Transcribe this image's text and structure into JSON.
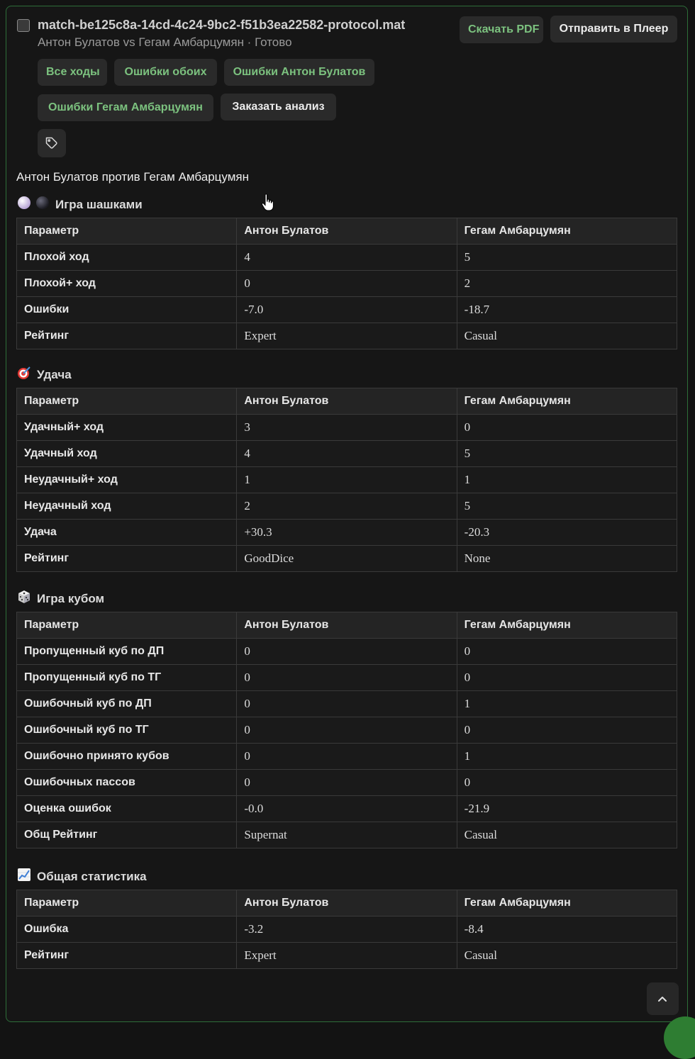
{
  "header": {
    "filename": "match-be125c8a-14cd-4c24-9bc2-f51b3ea22582-protocol.mat",
    "subtitle": "Антон Булатов vs Гегам Амбарцумян · Готово",
    "download_pdf": "Скачать PDF",
    "send_to_player": "Отправить в Плеер"
  },
  "filters": {
    "all_moves": "Все ходы",
    "both_errors": "Ошибки обоих",
    "errors_p1": "Ошибки Антон Булатов",
    "errors_p2": "Ошибки Гегам Амбарцумян",
    "order_analysis": "Заказать анализ"
  },
  "match_title": "Антон Булатов против Гегам Амбарцумян",
  "columns": [
    "Параметр",
    "Антон Булатов",
    "Гегам Амбарцумян"
  ],
  "sections": {
    "checkers": {
      "title": "Игра шашками",
      "icon": "checker-pieces-icon",
      "rows": [
        [
          "Плохой ход",
          "4",
          "5"
        ],
        [
          "Плохой+ ход",
          "0",
          "2"
        ],
        [
          "Ошибки",
          "-7.0",
          "-18.7"
        ],
        [
          "Рейтинг",
          "Expert",
          "Casual"
        ]
      ]
    },
    "luck": {
      "title": "Удача",
      "icon": "target-icon",
      "rows": [
        [
          "Удачный+ ход",
          "3",
          "0"
        ],
        [
          "Удачный ход",
          "4",
          "5"
        ],
        [
          "Неудачный+ ход",
          "1",
          "1"
        ],
        [
          "Неудачный ход",
          "2",
          "5"
        ],
        [
          "Удача",
          "+30.3",
          "-20.3"
        ],
        [
          "Рейтинг",
          "GoodDice",
          "None"
        ]
      ]
    },
    "cube": {
      "title": "Игра кубом",
      "icon": "dice-icon",
      "rows": [
        [
          "Пропущенный куб по ДП",
          "0",
          "0"
        ],
        [
          "Пропущенный куб по ТГ",
          "0",
          "0"
        ],
        [
          "Ошибочный куб по ДП",
          "0",
          "1"
        ],
        [
          "Ошибочный куб по ТГ",
          "0",
          "0"
        ],
        [
          "Ошибочно принято кубов",
          "0",
          "1"
        ],
        [
          "Ошибочных пассов",
          "0",
          "0"
        ],
        [
          "Оценка ошибок",
          "-0.0",
          "-21.9"
        ],
        [
          "Общ Рейтинг",
          "Supernat",
          "Casual"
        ]
      ]
    },
    "overall": {
      "title": "Общая статистика",
      "icon": "chart-increasing-icon",
      "rows": [
        [
          "Ошибка",
          "-3.2",
          "-8.4"
        ],
        [
          "Рейтинг",
          "Expert",
          "Casual"
        ]
      ]
    }
  },
  "colors": {
    "accent_green": "#7cc27f",
    "card_border": "#2d6e39",
    "background": "#131313"
  }
}
